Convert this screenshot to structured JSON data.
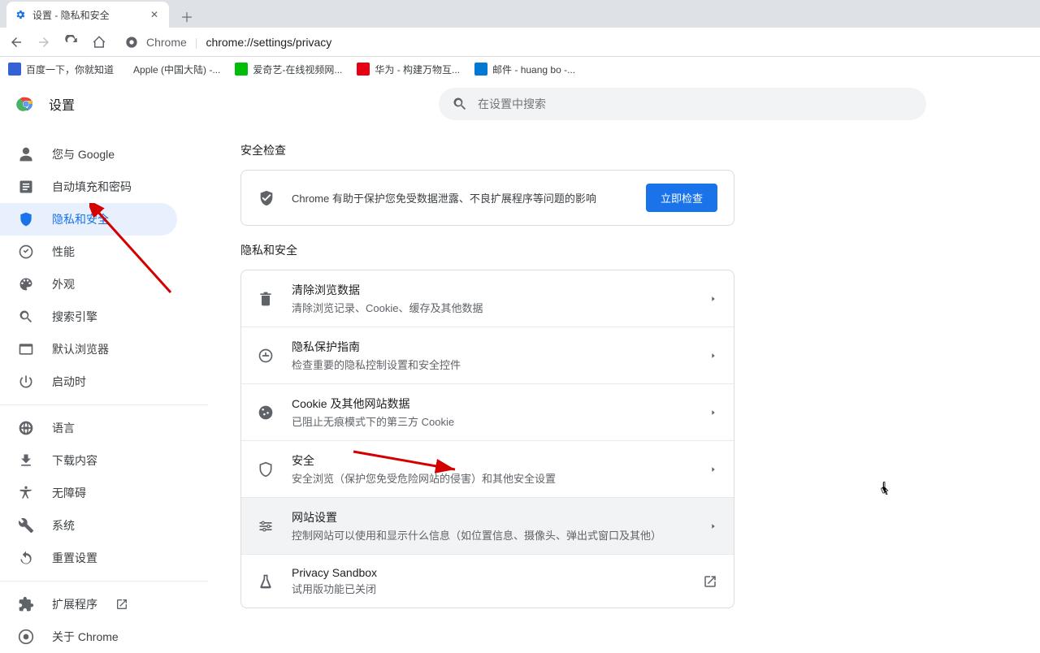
{
  "tab": {
    "title": "设置 - 隐私和安全"
  },
  "address": {
    "label": "Chrome",
    "url": "chrome://settings/privacy"
  },
  "bookmarks": [
    {
      "label": "百度一下，你就知道",
      "color": "#3561d6"
    },
    {
      "label": "Apple (中国大陆) -...",
      "color": "#808080"
    },
    {
      "label": "爱奇艺-在线视频网...",
      "color": "#00be06"
    },
    {
      "label": "华为 - 构建万物互...",
      "color": "#e60012"
    },
    {
      "label": "邮件 - huang bo -...",
      "color": "#0078d4"
    }
  ],
  "settings_title": "设置",
  "search": {
    "placeholder": "在设置中搜索"
  },
  "sidebar": {
    "items": [
      {
        "label": "您与 Google"
      },
      {
        "label": "自动填充和密码"
      },
      {
        "label": "隐私和安全"
      },
      {
        "label": "性能"
      },
      {
        "label": "外观"
      },
      {
        "label": "搜索引擎"
      },
      {
        "label": "默认浏览器"
      },
      {
        "label": "启动时"
      }
    ],
    "items2": [
      {
        "label": "语言"
      },
      {
        "label": "下载内容"
      },
      {
        "label": "无障碍"
      },
      {
        "label": "系统"
      },
      {
        "label": "重置设置"
      }
    ],
    "items3": [
      {
        "label": "扩展程序"
      },
      {
        "label": "关于 Chrome"
      }
    ]
  },
  "safety": {
    "title": "安全检查",
    "text": "Chrome 有助于保护您免受数据泄露、不良扩展程序等问题的影响",
    "button": "立即检查"
  },
  "privacy": {
    "title": "隐私和安全",
    "items": [
      {
        "title": "清除浏览数据",
        "sub": "清除浏览记录、Cookie、缓存及其他数据"
      },
      {
        "title": "隐私保护指南",
        "sub": "检查重要的隐私控制设置和安全控件"
      },
      {
        "title": "Cookie 及其他网站数据",
        "sub": "已阻止无痕模式下的第三方 Cookie"
      },
      {
        "title": "安全",
        "sub": "安全浏览（保护您免受危险网站的侵害）和其他安全设置"
      },
      {
        "title": "网站设置",
        "sub": "控制网站可以使用和显示什么信息（如位置信息、摄像头、弹出式窗口及其他）"
      },
      {
        "title": "Privacy Sandbox",
        "sub": "试用版功能已关闭"
      }
    ]
  }
}
